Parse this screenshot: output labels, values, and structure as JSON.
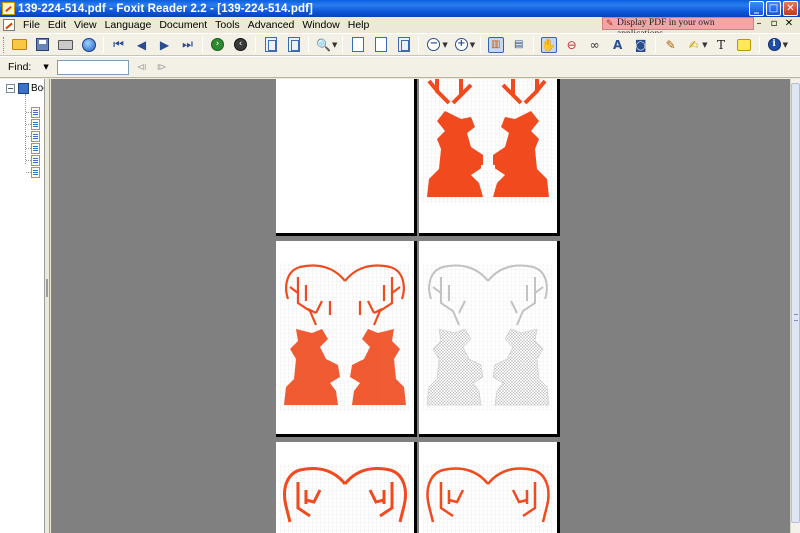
{
  "window": {
    "title": "139-224-514.pdf - Foxit Reader 2.2 - [139-224-514.pdf]",
    "minimize": "_",
    "maximize": "□",
    "close": "✕"
  },
  "menu": {
    "items": [
      "File",
      "Edit",
      "View",
      "Language",
      "Document",
      "Tools",
      "Advanced",
      "Window",
      "Help"
    ],
    "promo": "Display PDF in your own applications",
    "mdi_minimize": "–",
    "mdi_restore": "▫"
  },
  "find": {
    "label": "Find:",
    "value": ""
  },
  "bookmarks": {
    "root_label": "Boo",
    "child_count": 6
  },
  "document": {
    "pages": [
      "blank",
      "reindeer-bottom-red",
      "reindeer-red",
      "reindeer-grey",
      "antlers-red",
      "antlers-red"
    ]
  },
  "colors": {
    "stitch_red": "#f04a1e",
    "stitch_grey": "#c2c2c2",
    "workspace": "#808080"
  }
}
